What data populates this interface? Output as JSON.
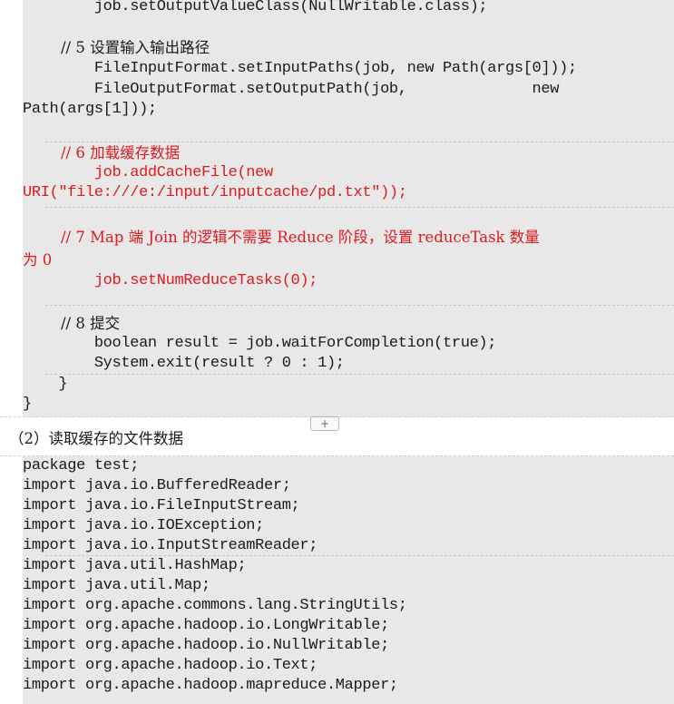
{
  "code_top": {
    "lines": [
      "        job.setOutputValueClass(NullWritable.class);",
      "",
      "        // 5 设置输入输出路径",
      "        FileInputFormat.setInputPaths(job, new Path(args[0]));",
      "        FileOutputFormat.setOutputPath(job,              new",
      "Path(args[1]));",
      "",
      "        // 6 加载缓存数据",
      "        job.addCacheFile(new",
      "URI(\"file:///e:/input/inputcache/pd.txt\"));",
      "",
      "        // 7 Map 端 Join 的逻辑不需要 Reduce 阶段，设置 reduceTask 数量",
      "为 0",
      "        job.setNumReduceTasks(0);",
      "",
      "        // 8 提交",
      "        boolean result = job.waitForCompletion(true);",
      "        System.exit(result ? 0 : 1);",
      "    }",
      "}"
    ]
  },
  "section": {
    "title": "（2）读取缓存的文件数据",
    "add_button": "+"
  },
  "code_bottom": {
    "lines": [
      "package test;",
      "import java.io.BufferedReader;",
      "import java.io.FileInputStream;",
      "import java.io.IOException;",
      "import java.io.InputStreamReader;",
      "import java.util.HashMap;",
      "import java.util.Map;",
      "import org.apache.commons.lang.StringUtils;",
      "import org.apache.hadoop.io.LongWritable;",
      "import org.apache.hadoop.io.NullWritable;",
      "import org.apache.hadoop.io.Text;",
      "import org.apache.hadoop.mapreduce.Mapper;"
    ]
  },
  "colors": {
    "code_bg": "#e8e8e8",
    "comment_red": "#e0191e",
    "text": "#1a1a1a"
  }
}
